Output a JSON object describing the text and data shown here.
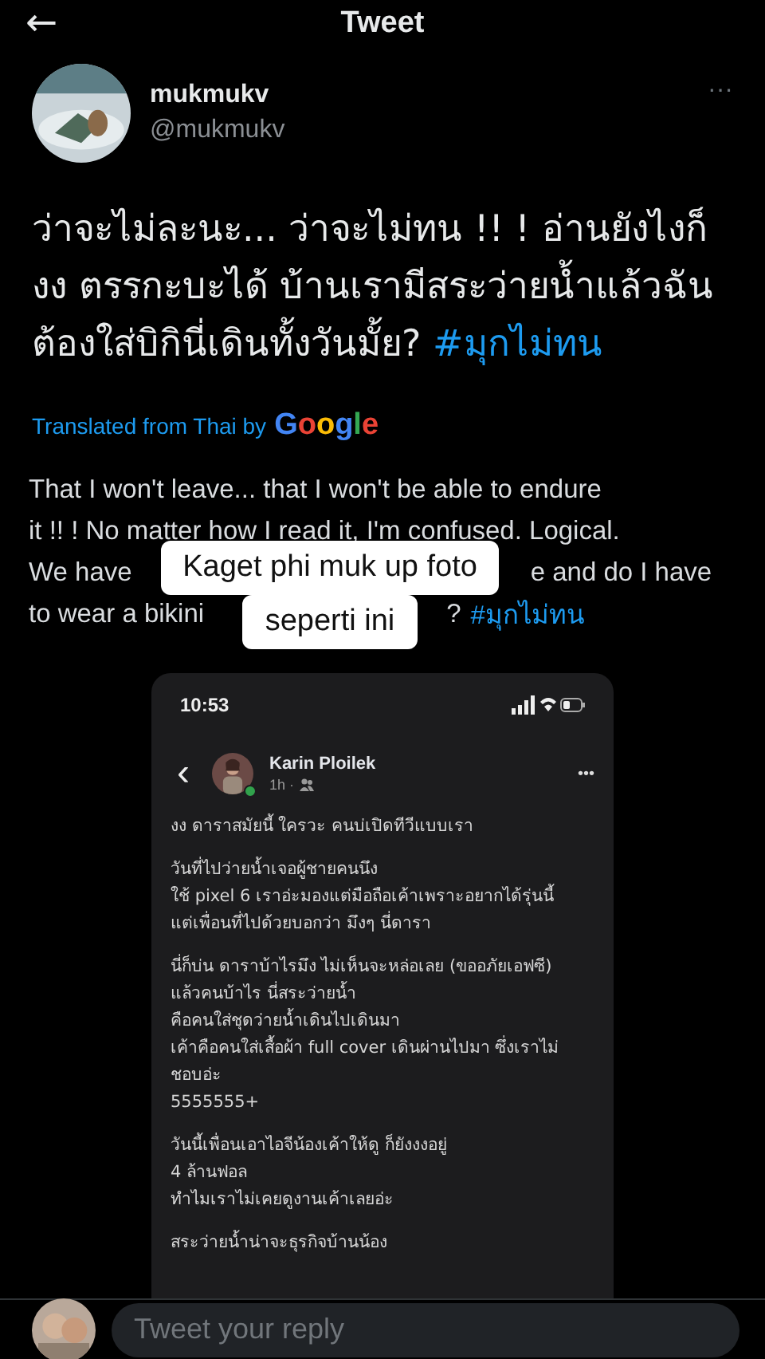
{
  "header": {
    "back": "←",
    "title": "Tweet"
  },
  "author": {
    "name": "mukmukv",
    "handle": "@mukmukv",
    "more": "···"
  },
  "tweet": {
    "lines": [
      "ว่าจะไม่ละนะ... ว่าจะไม่ทน !! ! อ่านยังไงก็",
      "งง ตรรกะบะได้ บ้านเรามีสระว่ายน้ำแล้วฉัน",
      "ต้องใส่บิกินี่เดินทั้งวันมั้ย?"
    ],
    "hashtag": "#มุกไม่ทน"
  },
  "translation": {
    "label": "Translated from Thai by",
    "provider": "Google",
    "lines": [
      {
        "segments": [
          {
            "kind": "plain",
            "text": "That I won't leave... that I won't be able to endure"
          }
        ]
      },
      {
        "segments": [
          {
            "kind": "plain",
            "text": "it !! ! No matter how I read it, I'm confused. Logical."
          }
        ]
      },
      {
        "segments": [
          {
            "kind": "plain",
            "text": "We have"
          },
          {
            "kind": "plain",
            "text": "e and do I have"
          }
        ]
      },
      {
        "segments": [
          {
            "kind": "plain",
            "text": "to wear a bikini"
          },
          {
            "kind": "plain",
            "text": "?"
          },
          {
            "kind": "hashtag",
            "text": "#มุกไม่ทน"
          }
        ]
      }
    ]
  },
  "caption": [
    "Kaget phi muk up foto",
    "seperti ini"
  ],
  "screenshot": {
    "time": "10:53",
    "poster": {
      "name": "Karin Ploilek",
      "age": "1h ·",
      "online": true
    },
    "more": "•••",
    "back": "‹",
    "paragraphs": [
      [
        "งง ดาราสมัยนี้ ใครวะ คนบ่เปิดทีวีแบบเรา"
      ],
      [
        "วันที่ไปว่ายน้ำเจอผู้ชายคนนึง",
        "ใช้ pixel 6 เราอ่ะมองแต่มือถือเค้าเพราะอยากได้รุ่นนี้",
        "แต่เพื่อนที่ไปด้วยบอกว่า มึงๆ นี่ดารา"
      ],
      [
        "นี่ก็บ่น ดาราบ้าไรมึง ไม่เห็นจะหล่อเลย (ขออภัยเอฟซี)",
        "แล้วคนบ้าไร นี่สระว่ายน้ำ",
        "คือคนใส่ชุดว่ายน้ำเดินไปเดินมา",
        "เค้าคือคนใส่เสื้อผ้า  full cover เดินผ่านไปมา ซึ่งเราไม่",
        "ชอบอ่ะ",
        "5555555+"
      ],
      [
        "วันนี้เพื่อนเอาไอจีน้องเค้าให้ดู ก็ยังงงอยู่",
        "4 ล้านฟอล",
        "ทำไมเราไม่เคยดูงานเค้าเลยอ่ะ"
      ],
      [
        "สระว่ายน้ำน่าจะธุรกิจบ้านน้อง"
      ]
    ]
  },
  "reply": {
    "placeholder": "Tweet your reply"
  }
}
